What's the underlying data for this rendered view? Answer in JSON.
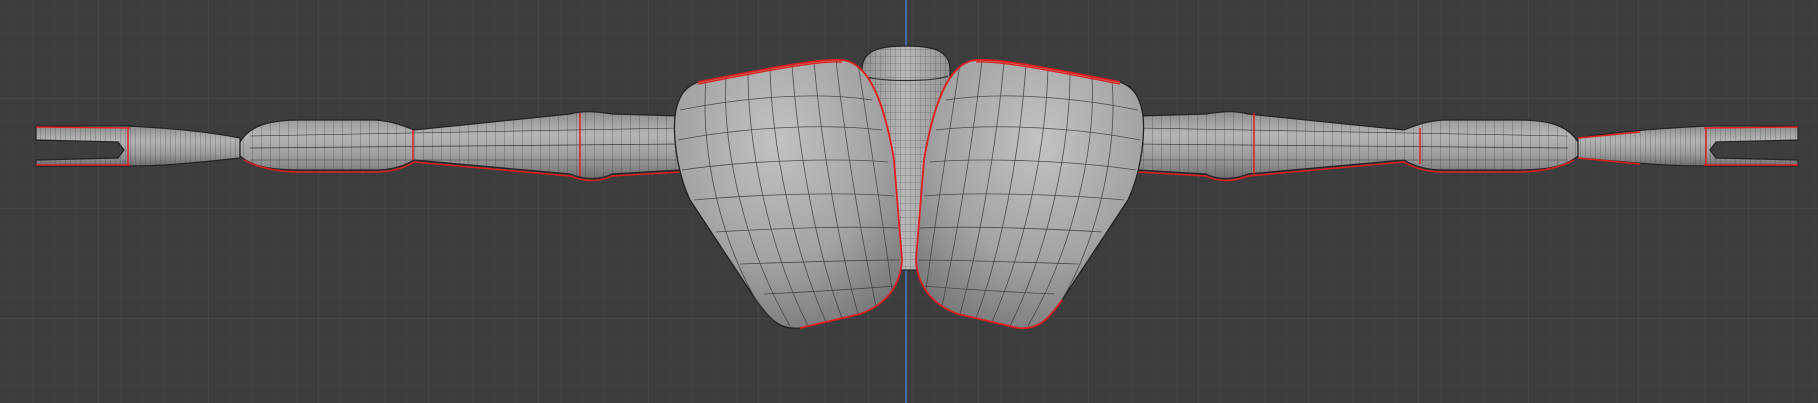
{
  "viewport": {
    "background": "#3d3d3d",
    "grid_minor_color": "#454545",
    "grid_major_color": "#4c4c4c",
    "axis_color": "#4a78c8",
    "seam_color": "#e02020",
    "mesh_fill": "#9c9c9c",
    "wire_color": "#2b2b2b"
  },
  "model": {
    "object": "character-mesh",
    "parts": [
      "head",
      "left-shoulder-pad",
      "right-shoulder-pad",
      "left-arm",
      "right-arm",
      "left-hand",
      "right-hand"
    ],
    "seams_marked": true
  }
}
